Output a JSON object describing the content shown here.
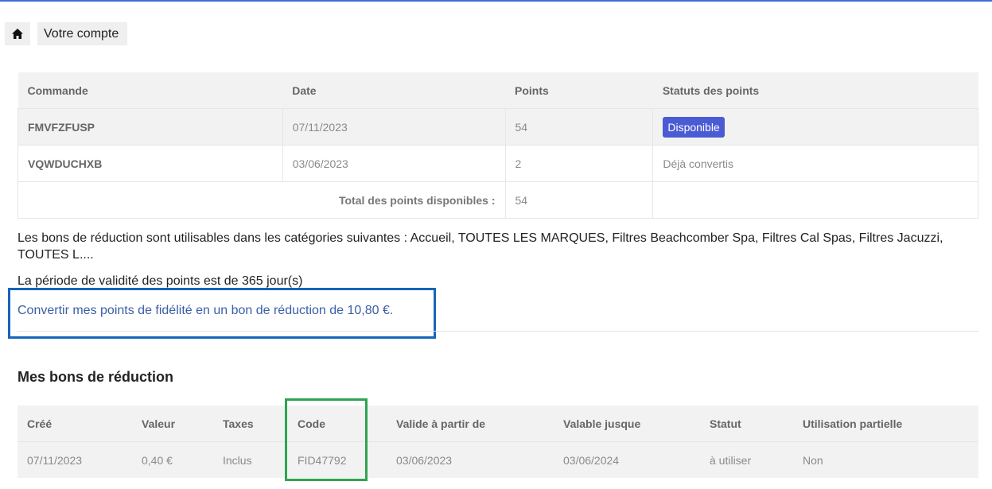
{
  "breadcrumb": {
    "home_icon": "home-icon",
    "items": [
      "Votre compte"
    ]
  },
  "points_table": {
    "headers": [
      "Commande",
      "Date",
      "Points",
      "Statuts des points"
    ],
    "rows": [
      {
        "commande": "FMVFZFUSP",
        "date": "07/11/2023",
        "points": "54",
        "statut": "Disponible"
      },
      {
        "commande": "VQWDUCHXB",
        "date": "03/06/2023",
        "points": "2",
        "statut": "Déjà convertis"
      }
    ],
    "total_label": "Total des points disponibles :",
    "total_value": "54"
  },
  "info_text": "Les bons de réduction sont utilisables dans les catégories suivantes : Accueil, TOUTES LES MARQUES, Filtres Beachcomber Spa, Filtres Cal Spas, Filtres Jacuzzi, TOUTES L....",
  "validity_text": "La période de validité des points est de 365 jour(s)",
  "convert_link": "Convertir mes points de fidélité en un bon de réduction de 10,80 €.",
  "vouchers": {
    "title": "Mes bons de réduction",
    "headers": [
      "Créé",
      "Valeur",
      "Taxes",
      "Code",
      "Valide à partir de",
      "Valable jusque",
      "Statut",
      "Utilisation partielle"
    ],
    "rows": [
      [
        "07/11/2023",
        "0,40 €",
        "Inclus",
        "FID47792",
        "03/06/2023",
        "03/06/2024",
        "à utiliser",
        "Non"
      ]
    ]
  },
  "colors": {
    "badge": "#4a5bd4",
    "highlight_blue": "#1566b8",
    "highlight_green": "#2ea44f",
    "link": "#3a5fa6"
  }
}
